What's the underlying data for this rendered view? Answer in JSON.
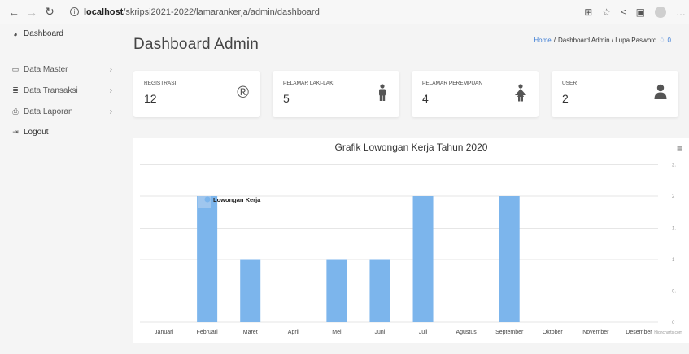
{
  "browser": {
    "url_host": "localhost",
    "url_path": "/skripsi2021-2022/lamarankerja/admin/dashboard"
  },
  "sidebar": {
    "brand": "Dashboard",
    "items": [
      {
        "label": "Data Master",
        "icon": "laptop-icon"
      },
      {
        "label": "Data Transaksi",
        "icon": "database-icon"
      },
      {
        "label": "Data Laporan",
        "icon": "print-icon"
      },
      {
        "label": "Logout",
        "icon": "logout-icon"
      }
    ]
  },
  "header": {
    "title": "Dashboard  Admin",
    "breadcrumb_home": "Home",
    "breadcrumb_sep": "/",
    "breadcrumb_rest": "Dashboard  Admin / Lupa Pasword",
    "notif_count": "0"
  },
  "cards": [
    {
      "label": "REGISTRASI",
      "value": "12",
      "icon": "registered-icon"
    },
    {
      "label": "PELAMAR LAKI-LAKI",
      "value": "5",
      "icon": "male-icon"
    },
    {
      "label": "PELAMAR PEREMPUAN",
      "value": "4",
      "icon": "female-icon"
    },
    {
      "label": "USER",
      "value": "2",
      "icon": "user-icon"
    }
  ],
  "chart_data": {
    "type": "bar",
    "title": "Grafik Lowongan Kerja Tahun 2020",
    "categories": [
      "Januari",
      "Februari",
      "Maret",
      "April",
      "Mei",
      "Juni",
      "Juli",
      "Agustus",
      "September",
      "Oktober",
      "November",
      "Desember"
    ],
    "series": [
      {
        "name": "Lowongan Kerja",
        "values": [
          0,
          2,
          1,
          0,
          1,
          1,
          2,
          0,
          2,
          0,
          0,
          0
        ]
      }
    ],
    "ylim": [
      0,
      2
    ],
    "yticks": [
      "0",
      "0.",
      "1",
      "1.",
      "2",
      "2."
    ],
    "credit": "Highcharts.com",
    "bar_color": "#7cb5ec",
    "grid": true,
    "legend_position": "top-left"
  }
}
